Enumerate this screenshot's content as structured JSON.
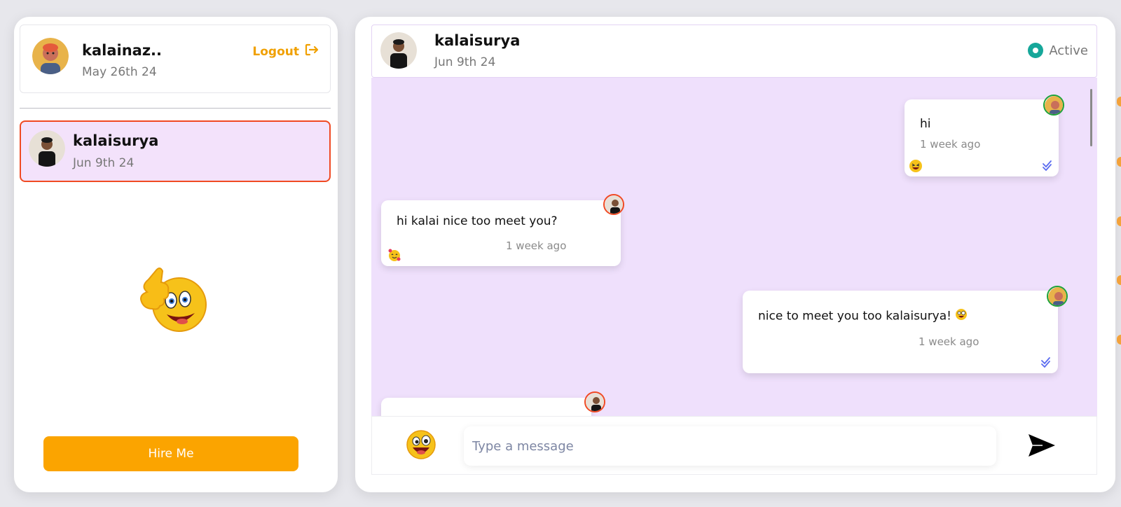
{
  "current_user": {
    "name": "kalainaz..",
    "joined": "May 26th 24",
    "logout_label": "Logout"
  },
  "contacts": [
    {
      "name": "kalaisurya",
      "date": "Jun 9th 24",
      "selected": true
    }
  ],
  "hire_button_label": "Hire Me",
  "chat": {
    "contact_name": "kalaisurya",
    "contact_date": "Jun 9th 24",
    "status_label": "Active",
    "messages": [
      {
        "text": "hi",
        "time": "1 week ago",
        "sender": "me",
        "reaction": "grinning-squint-emoji",
        "read": true
      },
      {
        "text": "hi kalai nice too meet you?",
        "time": "1 week ago",
        "sender": "contact",
        "reaction": "smiling-hearts-emoji"
      },
      {
        "text": "nice to meet you too kalaisurya!",
        "time": "1 week ago",
        "sender": "me",
        "inline_emoji": "zany-face-emoji",
        "read": true
      },
      {
        "text": "",
        "time": "",
        "sender": "contact"
      }
    ],
    "input_placeholder": "Type a message"
  },
  "icons": {
    "logout": "logout-icon",
    "emoji_picker": "zany-face-emoji",
    "send": "send-arrow-icon",
    "read_receipt": "double-check-icon",
    "status": "active-dot-icon"
  },
  "colors": {
    "accent": "#fba400",
    "selected_border": "#f04a23",
    "selected_bg": "#f3e2fb",
    "chat_bg": "#efe0fc",
    "status_active": "#16a79a",
    "read_tick": "#5b6cf0"
  }
}
